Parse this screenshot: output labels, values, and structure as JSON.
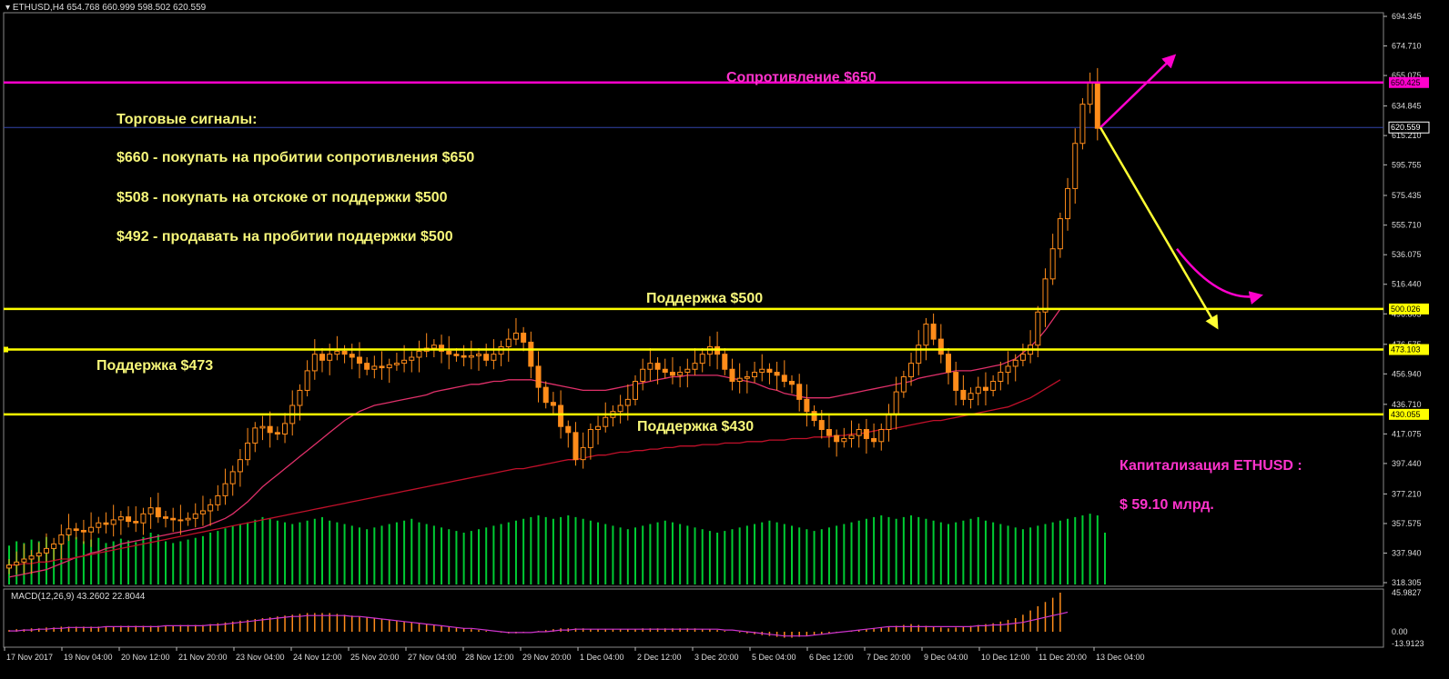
{
  "header": {
    "symbol": "ETHUSD,H4",
    "ohlc": "654.768 660.999 598.502 620.559"
  },
  "macd_header": "MACD(12,26,9) 43.2602 22.8044",
  "annotations": {
    "resistance_650": "Сопротивление $650",
    "signals_title": "Торговые сигналы:",
    "signal_1": "$660  - покупать на пробитии сопротивления $650",
    "signal_2": "$508 - покупать на отскоке от поддержки $500",
    "signal_3": "$492 - продавать на пробитии поддержки $500",
    "support_500": "Поддержка $500",
    "support_473": "Поддержка $473",
    "support_430": "Поддержка $430",
    "cap_title": "Капитализация ETHUSD :",
    "cap_value": "$ 59.10 млрд."
  },
  "colors": {
    "bull_candle": "#000000",
    "bear_candle": "#ff8c1a",
    "candle_outline": "#ff8c1a",
    "volume": "#00cc33",
    "ma_fast": "#e0306a",
    "ma_slow": "#c0102a",
    "support_line": "#ffff00",
    "resistance_line": "#ff00cc",
    "arrow_up": "#ff00cc",
    "arrow_down": "#ffff33",
    "macd_hist": "#ff8c1a",
    "macd_signal": "#cc33cc",
    "axis_text": "#dddddd",
    "price_box_bg": "#ffff00",
    "price_box_magenta": "#ff00cc"
  },
  "chart_data": {
    "type": "candlestick",
    "title": "ETHUSD,H4",
    "ylim": [
      318.305,
      694.345
    ],
    "x_ticks": [
      "17 Nov 2017",
      "19 Nov 04:00",
      "20 Nov 12:00",
      "21 Nov 20:00",
      "23 Nov 04:00",
      "24 Nov 12:00",
      "25 Nov 20:00",
      "27 Nov 04:00",
      "28 Nov 12:00",
      "29 Nov 20:00",
      "1 Dec 04:00",
      "2 Dec 12:00",
      "3 Dec 20:00",
      "5 Dec 04:00",
      "6 Dec 12:00",
      "7 Dec 20:00",
      "9 Dec 04:00",
      "10 Dec 12:00",
      "11 Dec 20:00",
      "13 Dec 04:00"
    ],
    "y_ticks": [
      "694.345",
      "674.710",
      "655.075",
      "634.845",
      "615.210",
      "595.755",
      "575.435",
      "555.710",
      "536.075",
      "516.440",
      "496.805",
      "476.575",
      "456.940",
      "436.710",
      "417.075",
      "397.440",
      "377.210",
      "357.575",
      "337.940",
      "318.305"
    ],
    "price_labels": [
      {
        "value": 650.425,
        "text": "650.425",
        "kind": "resistance"
      },
      {
        "value": 620.559,
        "text": "620.559",
        "kind": "current"
      },
      {
        "value": 500.026,
        "text": "500.026",
        "kind": "support"
      },
      {
        "value": 473.103,
        "text": "473.103",
        "kind": "support"
      },
      {
        "value": 430.055,
        "text": "430.055",
        "kind": "support"
      }
    ],
    "levels": [
      {
        "value": 650.425,
        "kind": "resistance"
      },
      {
        "value": 500.026,
        "kind": "support"
      },
      {
        "value": 473.103,
        "kind": "support"
      },
      {
        "value": 430.055,
        "kind": "support"
      }
    ],
    "closes": [
      330,
      332,
      334,
      336,
      338,
      341,
      344,
      350,
      354,
      353,
      352,
      355,
      358,
      357,
      360,
      362,
      359,
      358,
      364,
      368,
      362,
      361,
      360,
      360,
      361,
      364,
      366,
      370,
      376,
      384,
      392,
      400,
      411,
      421,
      422,
      418,
      417,
      424,
      436,
      446,
      459,
      470,
      466,
      470,
      472,
      470,
      468,
      464,
      460,
      462,
      461,
      463,
      464,
      466,
      468,
      472,
      474,
      476,
      472,
      470,
      469,
      468,
      469,
      470,
      466,
      470,
      475,
      480,
      484,
      478,
      462,
      448,
      438,
      436,
      422,
      418,
      400,
      408,
      420,
      422,
      428,
      432,
      436,
      440,
      452,
      460,
      464,
      460,
      458,
      456,
      458,
      460,
      464,
      470,
      475,
      470,
      460,
      452,
      454,
      455,
      458,
      460,
      458,
      456,
      452,
      450,
      440,
      432,
      426,
      420,
      416,
      412,
      414,
      416,
      420,
      414,
      412,
      420,
      430,
      445,
      455,
      464,
      476,
      490,
      480,
      470,
      458,
      446,
      440,
      444,
      448,
      446,
      452,
      458,
      462,
      466,
      470,
      476,
      498,
      520,
      540,
      560,
      580,
      610,
      636,
      650,
      620
    ],
    "ma_fast": [
      322,
      323,
      324,
      325,
      326,
      327,
      329,
      331,
      333,
      335,
      336,
      338,
      339,
      341,
      342,
      344,
      345,
      346,
      347,
      348,
      349,
      350,
      351,
      352,
      353,
      354,
      355,
      357,
      359,
      361,
      364,
      368,
      372,
      377,
      382,
      386,
      390,
      394,
      398,
      402,
      406,
      410,
      414,
      418,
      422,
      426,
      429,
      432,
      434,
      436,
      437,
      438,
      439,
      440,
      441,
      442,
      443,
      445,
      446,
      447,
      448,
      449,
      450,
      450,
      451,
      452,
      452,
      453,
      453,
      453,
      453,
      452,
      451,
      450,
      449,
      448,
      447,
      446,
      446,
      446,
      446,
      447,
      448,
      449,
      450,
      451,
      452,
      453,
      454,
      455,
      455,
      456,
      456,
      456,
      456,
      456,
      455,
      454,
      453,
      452,
      451,
      449,
      447,
      446,
      444,
      443,
      442,
      441,
      441,
      441,
      441,
      442,
      443,
      444,
      445,
      446,
      447,
      448,
      449,
      450,
      451,
      452,
      454,
      455,
      456,
      457,
      458,
      459,
      459,
      459,
      460,
      461,
      462,
      463,
      465,
      467,
      471,
      475,
      480,
      486,
      493,
      500
    ],
    "ma_slow": [
      330,
      330,
      331,
      331,
      332,
      332,
      333,
      334,
      334,
      335,
      336,
      337,
      338,
      339,
      340,
      341,
      342,
      343,
      344,
      345,
      346,
      347,
      348,
      349,
      350,
      351,
      352,
      353,
      354,
      355,
      356,
      357,
      358,
      359,
      360,
      361,
      362,
      363,
      364,
      365,
      366,
      367,
      368,
      369,
      370,
      371,
      372,
      373,
      374,
      375,
      376,
      377,
      378,
      379,
      380,
      381,
      382,
      383,
      384,
      385,
      386,
      387,
      388,
      389,
      390,
      391,
      392,
      393,
      394,
      394,
      395,
      396,
      397,
      398,
      399,
      400,
      400,
      401,
      402,
      403,
      403,
      404,
      405,
      405,
      406,
      406,
      407,
      407,
      408,
      408,
      409,
      409,
      409,
      410,
      410,
      410,
      411,
      411,
      411,
      412,
      412,
      412,
      413,
      413,
      413,
      414,
      414,
      414,
      415,
      415,
      415,
      416,
      416,
      417,
      417,
      418,
      419,
      420,
      420,
      421,
      422,
      423,
      424,
      425,
      426,
      426,
      427,
      428,
      429,
      430,
      431,
      432,
      433,
      434,
      435,
      437,
      439,
      441,
      444,
      447,
      450,
      453
    ],
    "volume": [
      0.45,
      0.5,
      0.48,
      0.52,
      0.5,
      0.55,
      0.47,
      0.58,
      0.6,
      0.55,
      0.5,
      0.52,
      0.54,
      0.48,
      0.5,
      0.53,
      0.51,
      0.49,
      0.55,
      0.6,
      0.58,
      0.5,
      0.48,
      0.5,
      0.52,
      0.54,
      0.56,
      0.6,
      0.62,
      0.65,
      0.68,
      0.7,
      0.72,
      0.75,
      0.78,
      0.76,
      0.74,
      0.72,
      0.7,
      0.72,
      0.74,
      0.76,
      0.78,
      0.74,
      0.72,
      0.7,
      0.68,
      0.66,
      0.64,
      0.66,
      0.68,
      0.7,
      0.72,
      0.74,
      0.76,
      0.72,
      0.7,
      0.68,
      0.66,
      0.64,
      0.62,
      0.6,
      0.62,
      0.64,
      0.66,
      0.68,
      0.7,
      0.72,
      0.74,
      0.76,
      0.78,
      0.8,
      0.78,
      0.76,
      0.78,
      0.8,
      0.78,
      0.76,
      0.74,
      0.72,
      0.7,
      0.68,
      0.66,
      0.64,
      0.66,
      0.68,
      0.7,
      0.72,
      0.74,
      0.72,
      0.7,
      0.68,
      0.66,
      0.64,
      0.62,
      0.6,
      0.62,
      0.64,
      0.66,
      0.68,
      0.7,
      0.72,
      0.74,
      0.72,
      0.7,
      0.68,
      0.66,
      0.64,
      0.62,
      0.64,
      0.66,
      0.68,
      0.7,
      0.72,
      0.74,
      0.76,
      0.78,
      0.8,
      0.78,
      0.76,
      0.78,
      0.8,
      0.78,
      0.76,
      0.74,
      0.72,
      0.7,
      0.72,
      0.74,
      0.76,
      0.78,
      0.74,
      0.72,
      0.7,
      0.68,
      0.66,
      0.64,
      0.66,
      0.68,
      0.7,
      0.72,
      0.74,
      0.76,
      0.78,
      0.8,
      0.82,
      0.8,
      0.6
    ],
    "macd": {
      "ylim": [
        -13.9123,
        45.9827
      ],
      "y_ticks": [
        "45.9827",
        "0.00",
        "-13.9123"
      ],
      "hist": [
        2,
        3,
        3,
        4,
        4,
        5,
        5,
        6,
        6,
        6,
        6,
        6,
        6,
        6,
        6,
        7,
        7,
        7,
        7,
        7,
        7,
        7,
        7,
        8,
        8,
        8,
        8,
        9,
        10,
        11,
        12,
        13,
        14,
        15,
        16,
        17,
        18,
        19,
        20,
        21,
        22,
        22,
        22,
        22,
        21,
        20,
        19,
        18,
        17,
        16,
        15,
        14,
        13,
        12,
        11,
        10,
        9,
        8,
        7,
        6,
        5,
        4,
        3,
        2,
        1,
        0,
        -1,
        -2,
        -2,
        -1,
        0,
        1,
        2,
        3,
        4,
        4,
        4,
        4,
        3,
        3,
        3,
        3,
        3,
        3,
        3,
        4,
        4,
        4,
        4,
        4,
        4,
        4,
        4,
        3,
        3,
        2,
        1,
        0,
        -1,
        -2,
        -3,
        -4,
        -5,
        -6,
        -7,
        -7,
        -6,
        -5,
        -4,
        -3,
        -2,
        -1,
        0,
        1,
        2,
        3,
        4,
        5,
        6,
        7,
        8,
        9,
        8,
        7,
        6,
        5,
        4,
        5,
        6,
        7,
        8,
        9,
        10,
        12,
        14,
        16,
        20,
        25,
        30,
        35,
        40,
        46
      ],
      "signal": [
        1,
        1,
        2,
        2,
        3,
        3,
        4,
        4,
        5,
        5,
        5,
        5,
        5,
        6,
        6,
        6,
        6,
        6,
        6,
        6,
        6,
        7,
        7,
        7,
        7,
        7,
        7,
        8,
        8,
        9,
        10,
        11,
        12,
        13,
        14,
        15,
        16,
        17,
        18,
        18,
        19,
        19,
        19,
        19,
        19,
        19,
        18,
        18,
        17,
        16,
        15,
        14,
        13,
        12,
        11,
        10,
        9,
        8,
        7,
        6,
        5,
        4,
        4,
        3,
        2,
        1,
        0,
        -1,
        -1,
        -1,
        -1,
        0,
        0,
        1,
        2,
        2,
        3,
        3,
        3,
        3,
        3,
        3,
        3,
        3,
        3,
        3,
        3,
        3,
        3,
        3,
        3,
        3,
        3,
        3,
        3,
        3,
        2,
        2,
        1,
        0,
        -1,
        -2,
        -3,
        -4,
        -5,
        -5,
        -5,
        -5,
        -4,
        -3,
        -2,
        -1,
        0,
        1,
        2,
        3,
        4,
        5,
        6,
        6,
        6,
        6,
        6,
        6,
        6,
        6,
        6,
        6,
        6,
        6,
        7,
        7,
        8,
        8,
        9,
        10,
        11,
        13,
        15,
        17,
        19,
        21,
        23
      ]
    }
  }
}
